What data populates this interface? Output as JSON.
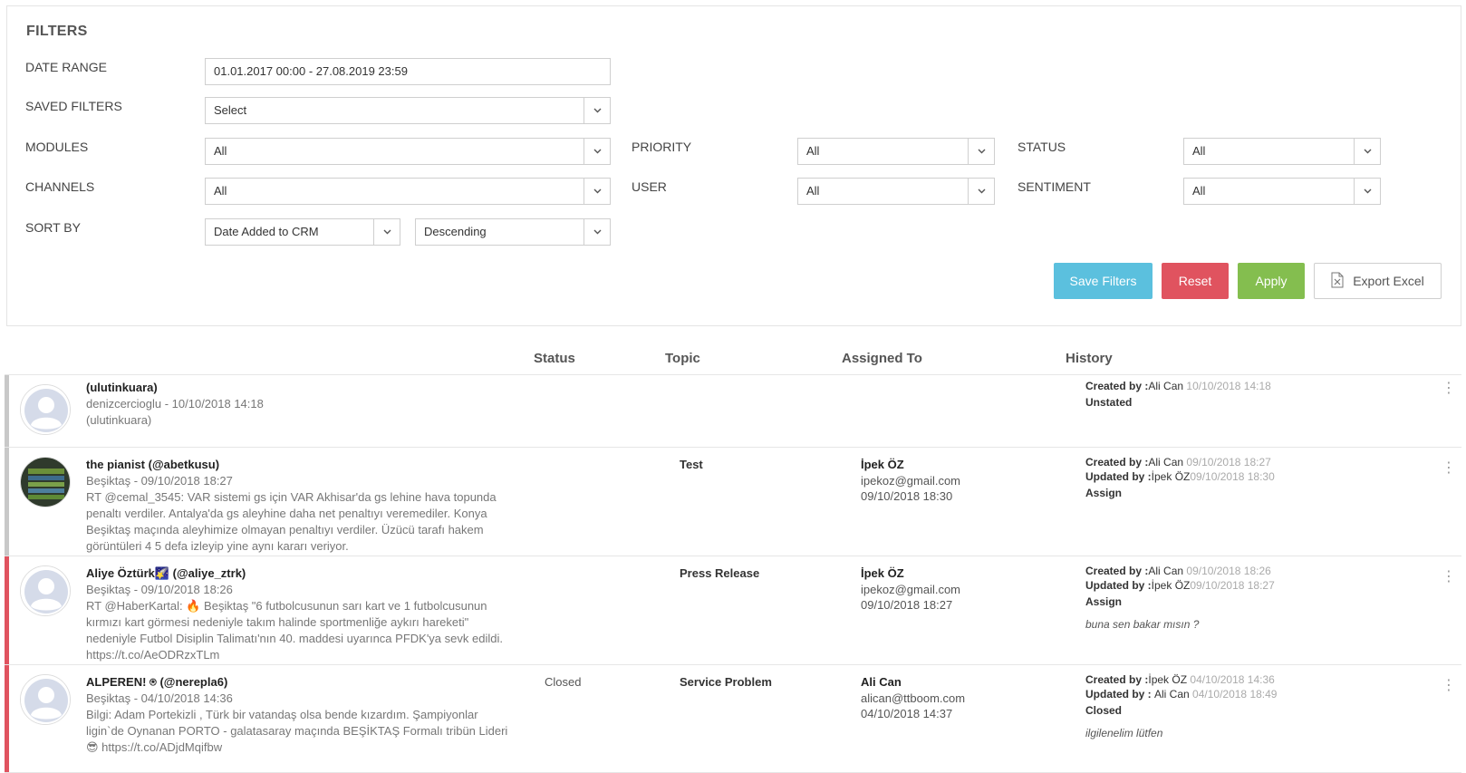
{
  "filters": {
    "title": "FILTERS",
    "date_range": {
      "label": "DATE RANGE",
      "value": "01.01.2017 00:00 - 27.08.2019 23:59"
    },
    "saved_filters": {
      "label": "SAVED FILTERS",
      "value": "Select"
    },
    "modules": {
      "label": "MODULES",
      "value": "All"
    },
    "channels": {
      "label": "CHANNELS",
      "value": "All"
    },
    "sort_by": {
      "label": "SORT BY",
      "field": "Date Added to CRM",
      "order": "Descending"
    },
    "priority": {
      "label": "PRIORITY",
      "value": "All"
    },
    "user": {
      "label": "USER",
      "value": "All"
    },
    "status": {
      "label": "STATUS",
      "value": "All"
    },
    "sentiment": {
      "label": "SENTIMENT",
      "value": "All"
    },
    "buttons": {
      "save": "Save Filters",
      "reset": "Reset",
      "apply": "Apply",
      "export": "Export Excel"
    }
  },
  "table": {
    "headers": {
      "status": "Status",
      "topic": "Topic",
      "assigned": "Assigned To",
      "history": "History"
    },
    "rows": [
      {
        "name": "(ulutinkuara)",
        "meta": "denizcercioglu - 10/10/2018 14:18",
        "text": "(ulutinkuara)",
        "status": "",
        "topic": "",
        "assigned_name": "",
        "assigned_email": "",
        "assigned_date": "",
        "created_label": "Created by :",
        "created_by": "Ali Can",
        "created_date": "10/10/2018 14:18",
        "updated_label": "",
        "updated_by": "",
        "updated_date": "",
        "state": "Unstated",
        "note": "",
        "bar_color": "#c8c8c8"
      },
      {
        "name": "the pianist (@abetkusu)",
        "meta": "Beşiktaş - 09/10/2018 18:27",
        "text": "RT @cemal_3545: VAR sistemi gs için VAR Akhisar'da gs lehine hava topunda penaltı verdiler. Antalya'da gs aleyhine daha net penaltıyı veremediler. Konya Beşiktaş maçında aleyhimize olmayan penaltıyı verdiler. Üzücü tarafı hakem görüntüleri 4 5 defa izleyip yine aynı kararı veriyor.",
        "status": "",
        "topic": "Test",
        "assigned_name": "İpek ÖZ",
        "assigned_email": "ipekoz@gmail.com",
        "assigned_date": "09/10/2018 18:30",
        "created_label": "Created by :",
        "created_by": "Ali Can",
        "created_date": "09/10/2018 18:27",
        "updated_label": "Updated by :",
        "updated_by": "İpek ÖZ",
        "updated_date": "09/10/2018 18:30",
        "state": "Assign",
        "note": "",
        "bar_color": "#c8c8c8"
      },
      {
        "name": "Aliye Öztürk🌠 (@aliye_ztrk)",
        "meta": "Beşiktaş - 09/10/2018 18:26",
        "text": "RT @HaberKartal: 🔥 Beşiktaş \"6 futbolcusunun sarı kart ve 1 futbolcusunun kırmızı kart görmesi nedeniyle takım halinde sportmenliğe aykırı hareketi\" nedeniyle Futbol Disiplin Talimatı'nın 40. maddesi uyarınca PFDK'ya sevk edildi. https://t.co/AeODRzxTLm",
        "status": "",
        "topic": "Press Release",
        "assigned_name": "İpek ÖZ",
        "assigned_email": "ipekoz@gmail.com",
        "assigned_date": "09/10/2018 18:27",
        "created_label": "Created by :",
        "created_by": "Ali Can",
        "created_date": "09/10/2018 18:26",
        "updated_label": "Updated by :",
        "updated_by": "İpek ÖZ",
        "updated_date": "09/10/2018 18:27",
        "state": "Assign",
        "note": "buna sen bakar mısın ?",
        "bar_color": "#e0535f"
      },
      {
        "name": "ALPEREN! ⍟ (@nerepla6)",
        "meta": "Beşiktaş - 04/10/2018 14:36",
        "text": "Bilgi: Adam Portekizli , Türk bir vatandaş olsa bende kızardım. Şampiyonlar ligin`de Oynanan PORTO - galatasaray maçında BEŞİKTAŞ Formalı tribün Lideri 😎 https://t.co/ADjdMqifbw",
        "status": "Closed",
        "topic": "Service Problem",
        "assigned_name": "Ali Can",
        "assigned_email": "alican@ttboom.com",
        "assigned_date": "04/10/2018 14:37",
        "created_label": "Created by :",
        "created_by": "İpek ÖZ",
        "created_date": "04/10/2018 14:36",
        "updated_label": "Updated by : ",
        "updated_by": "Ali Can",
        "updated_date": "04/10/2018 18:49",
        "state": "Closed",
        "note": "ilgilenelim lütfen",
        "bar_color": "#e0535f"
      }
    ]
  }
}
